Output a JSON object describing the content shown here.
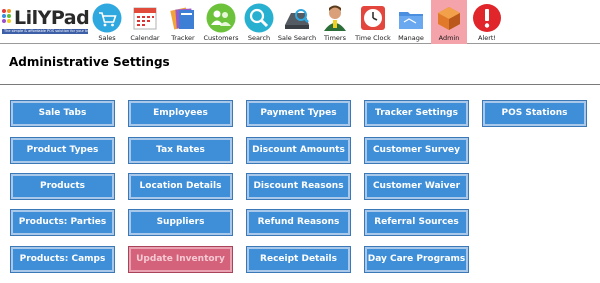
{
  "app": {
    "logo_text": "LilYPad",
    "logo_tagline": "The simple & affordable POS solution for your business"
  },
  "nav": {
    "items": [
      {
        "label": "Sales",
        "icon": "shopping-cart-icon",
        "active": false
      },
      {
        "label": "Calendar",
        "icon": "calendar-icon",
        "active": false
      },
      {
        "label": "Tracker",
        "icon": "folders-icon",
        "active": false
      },
      {
        "label": "Customers",
        "icon": "people-icon",
        "active": false
      },
      {
        "label": "Search",
        "icon": "magnifier-icon",
        "active": false
      },
      {
        "label": "Sale Search",
        "icon": "register-icon",
        "active": false
      },
      {
        "label": "Timers",
        "icon": "staff-icon",
        "active": false
      },
      {
        "label": "Time Clock",
        "icon": "clock-icon",
        "active": false
      },
      {
        "label": "Manage",
        "icon": "folder-icon",
        "active": false
      },
      {
        "label": "Admin",
        "icon": "admin-cube-icon",
        "active": true
      },
      {
        "label": "Alert!",
        "icon": "alert-icon",
        "active": false
      }
    ]
  },
  "page": {
    "title": "Administrative Settings"
  },
  "settings": {
    "columns": [
      [
        "Sale Tabs",
        "Product Types",
        "Products",
        "Products: Parties",
        "Products: Camps"
      ],
      [
        "Employees",
        "Tax Rates",
        "Location Details",
        "Suppliers",
        "Update Inventory"
      ],
      [
        "Payment Types",
        "Discount Amounts",
        "Discount Reasons",
        "Refund Reasons",
        "Receipt Details"
      ],
      [
        "Tracker Settings",
        "Customer Survey",
        "Customer Waiver",
        "Referral Sources",
        "Day Care Programs"
      ],
      [
        "POS Stations"
      ]
    ],
    "highlighted": "Update Inventory"
  },
  "colors": {
    "button": "#3f8fd8",
    "button_highlight": "#d4627a",
    "nav_active": "#f4a3ab"
  }
}
